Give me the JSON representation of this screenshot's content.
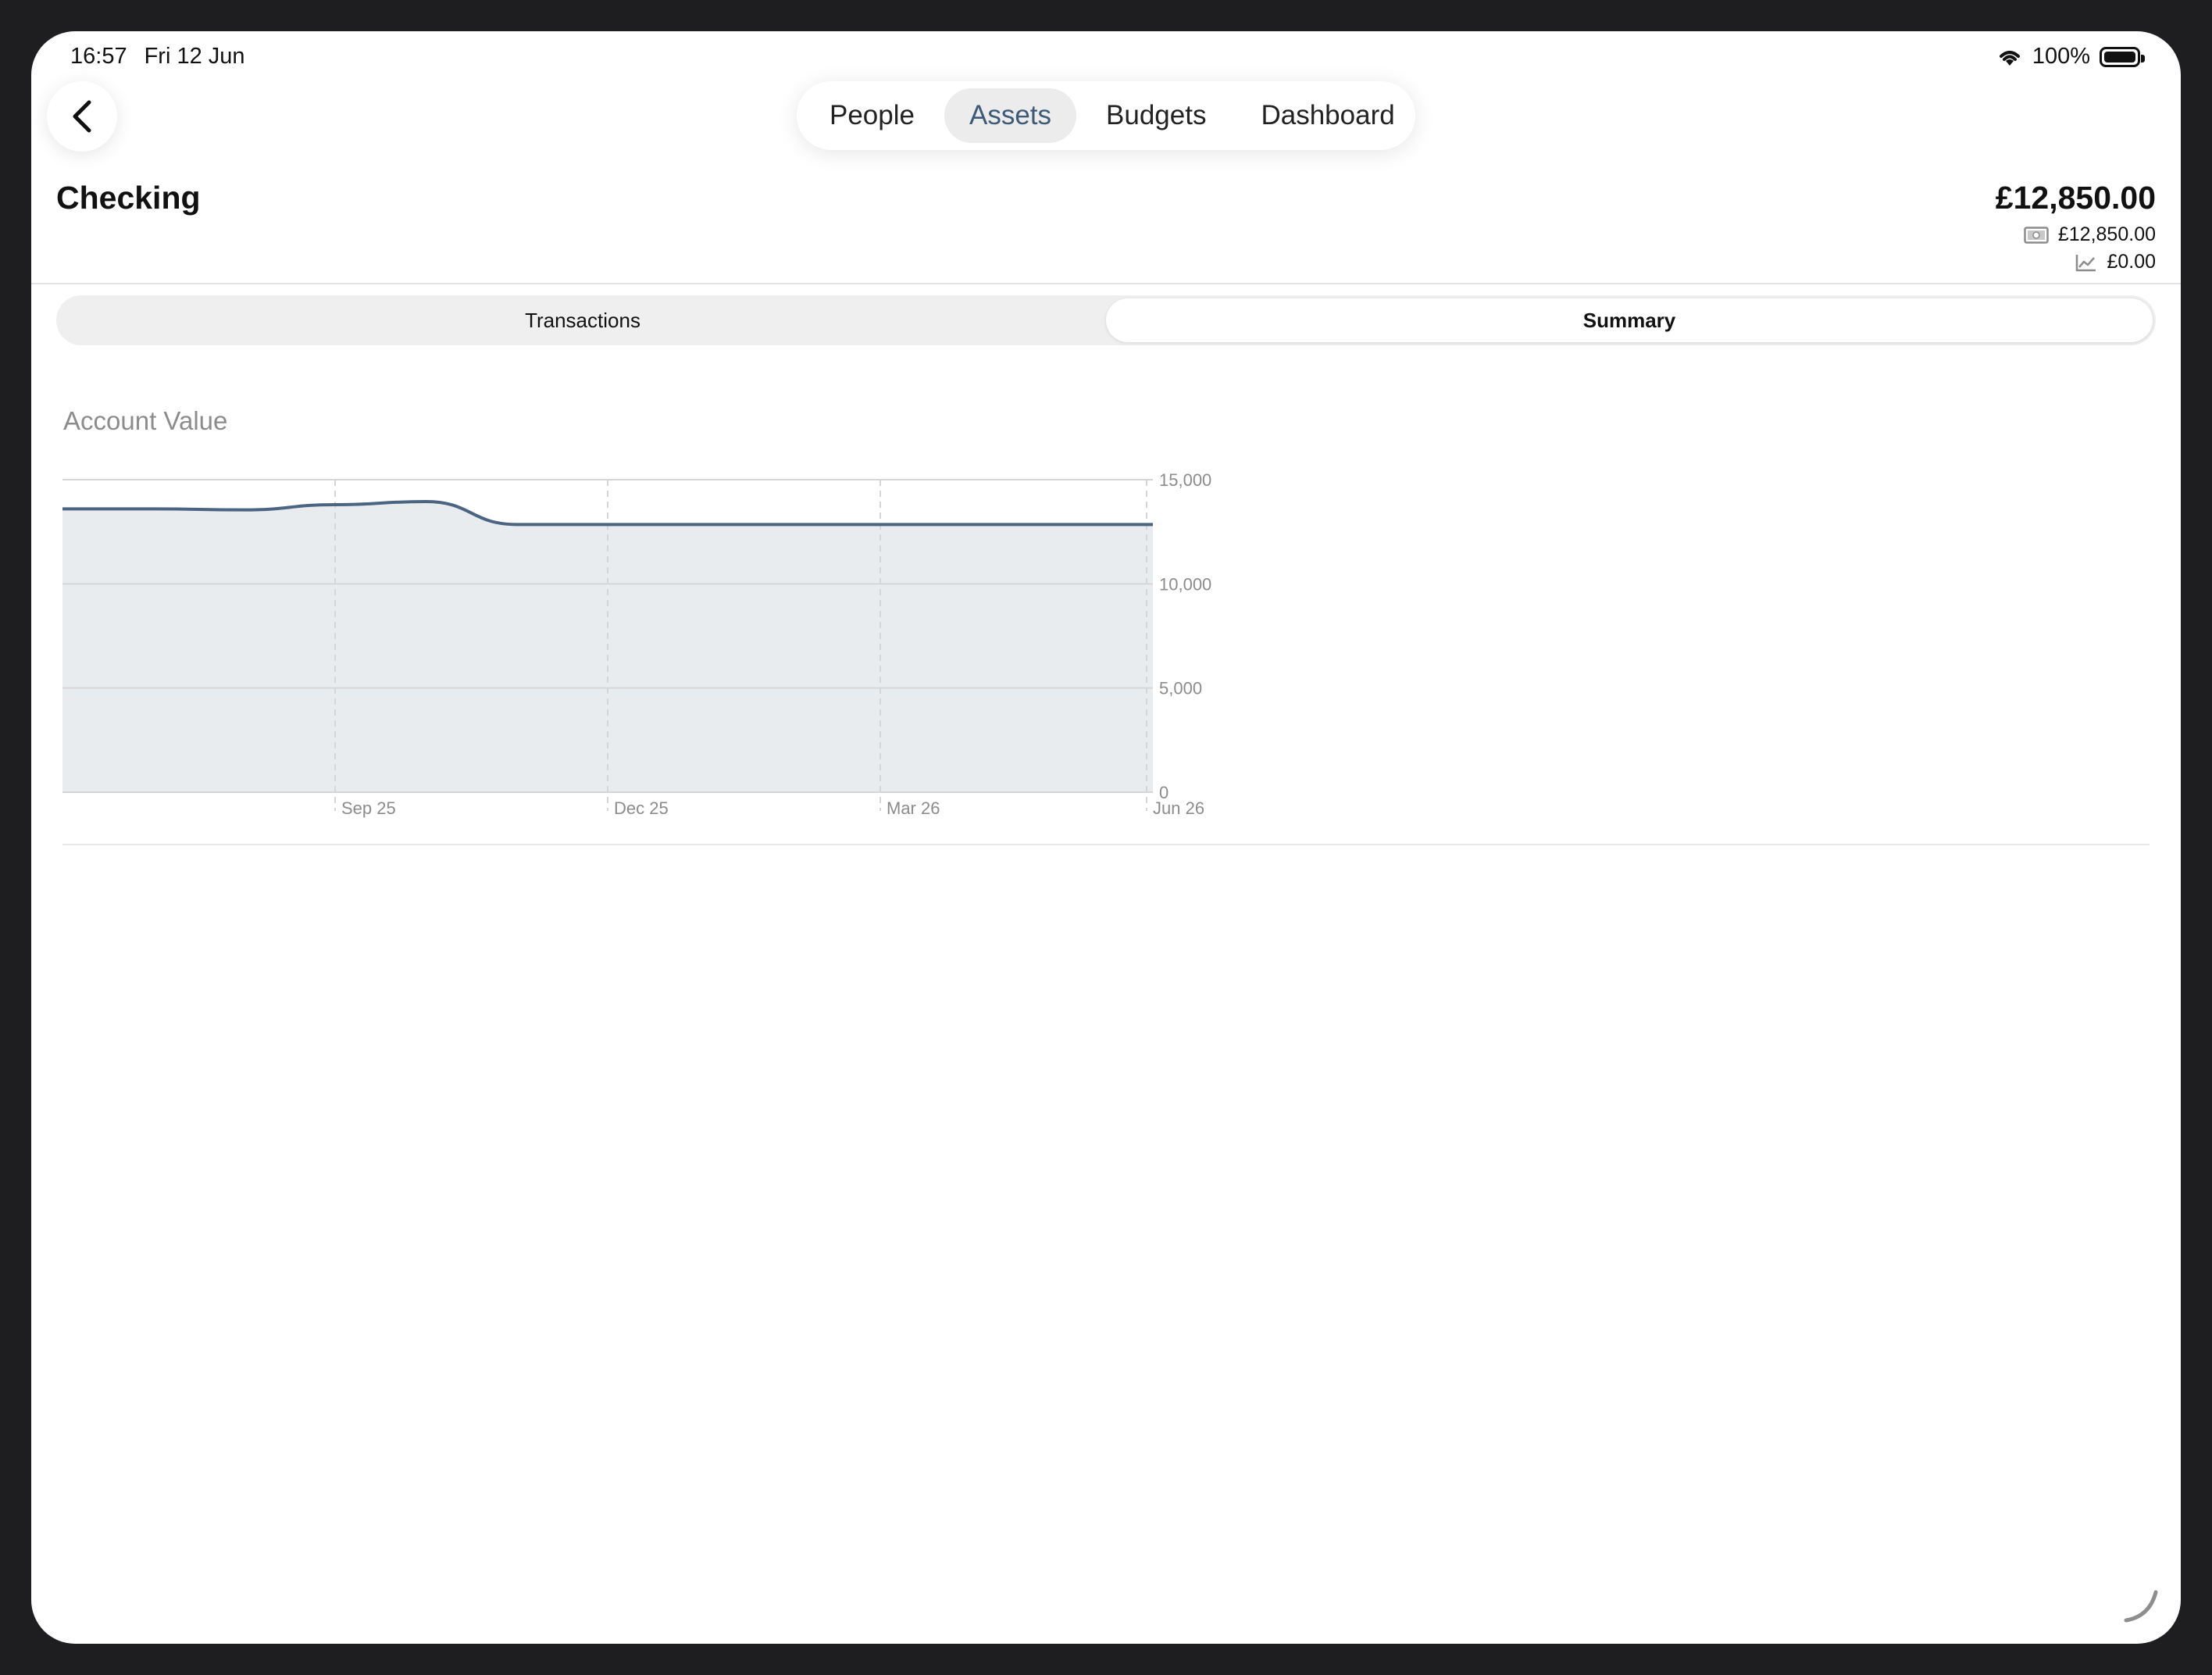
{
  "status_bar": {
    "time": "16:57",
    "date": "Fri 12 Jun",
    "battery": "100%"
  },
  "nav_tabs": [
    {
      "label": "People"
    },
    {
      "label": "Assets"
    },
    {
      "label": "Budgets"
    },
    {
      "label": "Dashboard"
    }
  ],
  "active_tab": "Assets",
  "account": {
    "name": "Checking",
    "total": "£12,850.00",
    "cash": "£12,850.00",
    "investments": "£0.00"
  },
  "segments": [
    {
      "label": "Transactions"
    },
    {
      "label": "Summary"
    }
  ],
  "active_segment": "Summary",
  "colors": {
    "accent": "#3d5a78",
    "area_fill": "#e9ecef",
    "line": "#4a6482",
    "grid": "#d6d6d6",
    "tick_text": "#8c8c8c"
  },
  "chart_data": {
    "type": "area",
    "title": "Account Value",
    "xlabel": "",
    "ylabel": "",
    "ylim": [
      0,
      15000
    ],
    "y_ticks": [
      "15,000",
      "10,000",
      "5,000",
      "0"
    ],
    "x_ticks": [
      "Sep 25",
      "Dec 25",
      "Mar 26",
      "Jun 26"
    ],
    "series": [
      {
        "x": [
          "Jun 25",
          "Jul 25",
          "Aug 25",
          "Sep 25",
          "Oct 25",
          "Nov 25",
          "Dec 25",
          "Jan 26",
          "Feb 26",
          "Mar 26",
          "Apr 26",
          "May 26",
          "Jun 26"
        ],
        "values": [
          13600,
          13600,
          13550,
          13800,
          13950,
          12850,
          12850,
          12850,
          12850,
          12850,
          12850,
          12850,
          12850
        ]
      }
    ],
    "grid": true
  }
}
